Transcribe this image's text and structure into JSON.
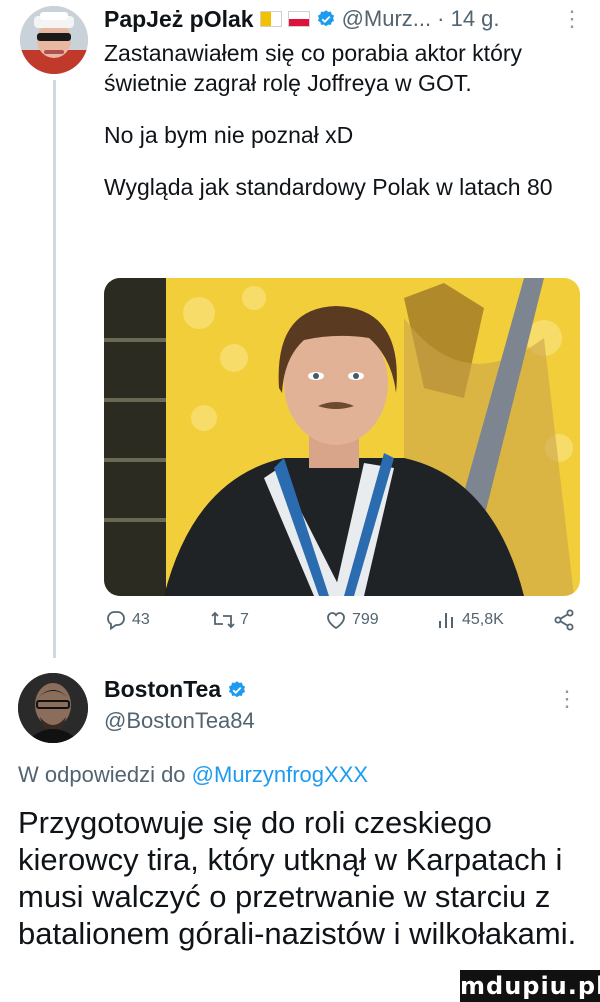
{
  "tweet": {
    "author_name": "PapJeż pOlak",
    "handle": "@Murz...",
    "time": "· 14 g.",
    "paragraphs": [
      "Zastanawiałem się co porabia aktor który świetnie zagrał rolę Joffreya w GOT.",
      "No ja bym nie poznał xD",
      "Wygląda jak standardowy Polak w latach 80"
    ],
    "stats": {
      "replies": "43",
      "retweets": "7",
      "likes": "799",
      "views": "45,8K"
    }
  },
  "reply": {
    "author_name": "BostonTea",
    "handle": "@BostonTea84",
    "reply_prefix": "W odpowiedzi do ",
    "reply_to": "@MurzynfrogXXX",
    "text": "Przygotowuje się do roli czeskiego kierowcy tira, który utknął w Karpatach i musi walczyć o przetrwanie w starciu z batalionem górali-nazistów i wilkołakami."
  },
  "watermark": "mdupiu.pl",
  "colors": {
    "text": "#0f1419",
    "secondary": "#536471",
    "link": "#1d9bf0",
    "verified": "#1d9bf0"
  },
  "icons": [
    "reply-icon",
    "retweet-icon",
    "like-icon",
    "views-icon",
    "share-icon",
    "verified-icon",
    "more-icon"
  ]
}
